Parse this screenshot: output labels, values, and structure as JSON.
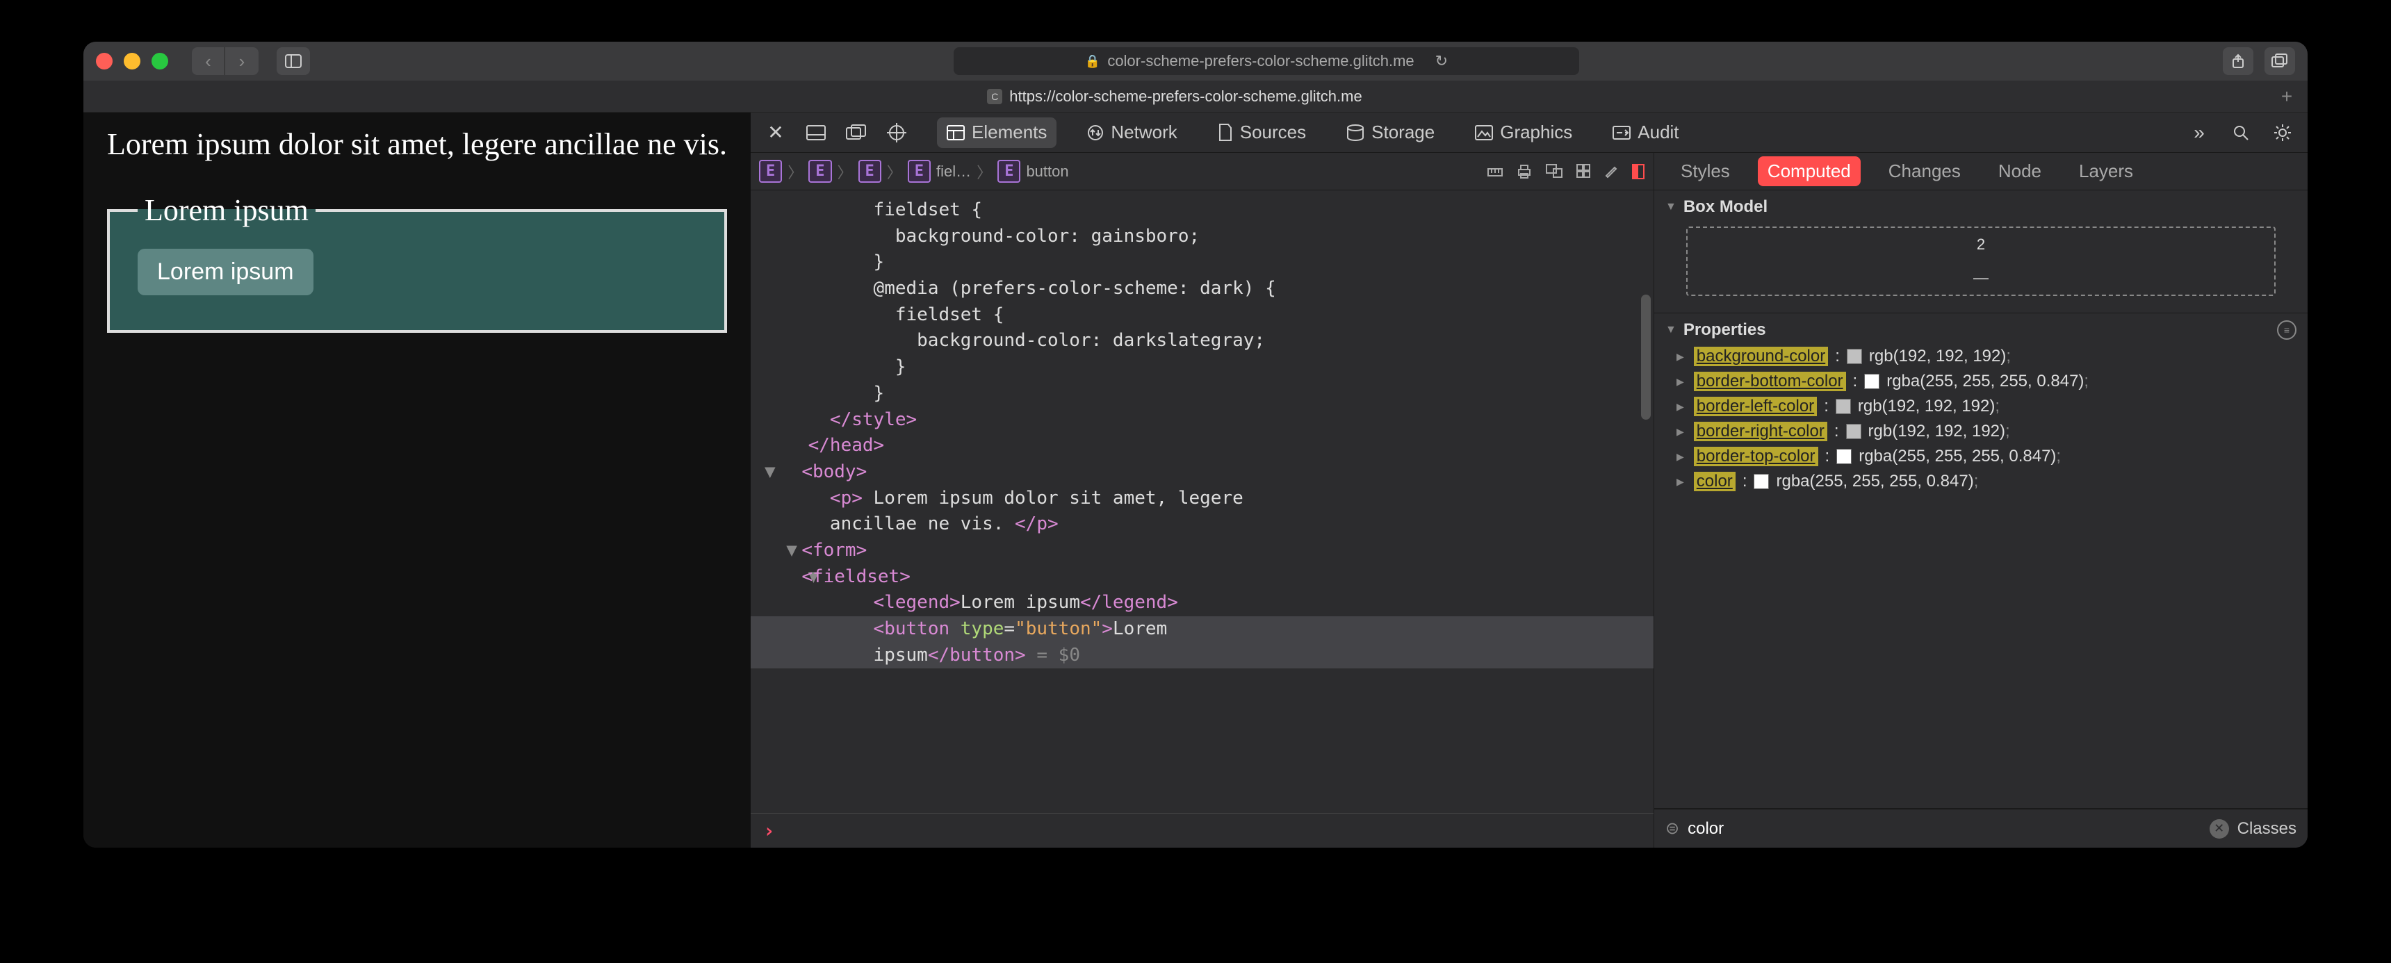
{
  "titlebar": {
    "url_display": "color-scheme-prefers-color-scheme.glitch.me"
  },
  "tab": {
    "title": "https://color-scheme-prefers-color-scheme.glitch.me"
  },
  "page": {
    "paragraph": "Lorem ipsum dolor sit amet, legere ancillae ne vis.",
    "legend": "Lorem ipsum",
    "button": "Lorem ipsum"
  },
  "devtools": {
    "panels": {
      "elements": "Elements",
      "network": "Network",
      "sources": "Sources",
      "storage": "Storage",
      "graphics": "Graphics",
      "audit": "Audit"
    },
    "breadcrumbs": [
      "fiel…",
      "button"
    ],
    "dom_lines": [
      "          fieldset {",
      "            background-color: gainsboro;",
      "          }",
      "          @media (prefers-color-scheme: dark) {",
      "            fieldset {",
      "              background-color: darkslategray;",
      "            }",
      "          }",
      "      </style>",
      "    </head>",
      "    <body>",
      "      <p> Lorem ipsum dolor sit amet, legere ancillae ne vis. </p>",
      "      <form>",
      "        <fieldset>",
      "          <legend>Lorem ipsum</legend>",
      "          <button type=\"button\">Lorem ipsum</button> = $0"
    ],
    "right_tabs": {
      "styles": "Styles",
      "computed": "Computed",
      "changes": "Changes",
      "node": "Node",
      "layers": "Layers"
    },
    "box_model": {
      "title": "Box Model",
      "top": "2",
      "bottom": "—"
    },
    "properties_title": "Properties",
    "properties": [
      {
        "name": "background-color",
        "swatch": "#c0c0c0",
        "value": "rgb(192, 192, 192)"
      },
      {
        "name": "border-bottom-color",
        "swatch": "#ffffff",
        "value": "rgba(255, 255, 255, 0.847)"
      },
      {
        "name": "border-left-color",
        "swatch": "#c0c0c0",
        "value": "rgb(192, 192, 192)"
      },
      {
        "name": "border-right-color",
        "swatch": "#c0c0c0",
        "value": "rgb(192, 192, 192)"
      },
      {
        "name": "border-top-color",
        "swatch": "#ffffff",
        "value": "rgba(255, 255, 255, 0.847)"
      },
      {
        "name": "color",
        "swatch": "#ffffff",
        "value": "rgba(255, 255, 255, 0.847)"
      }
    ],
    "filter_value": "color",
    "classes_label": "Classes"
  }
}
